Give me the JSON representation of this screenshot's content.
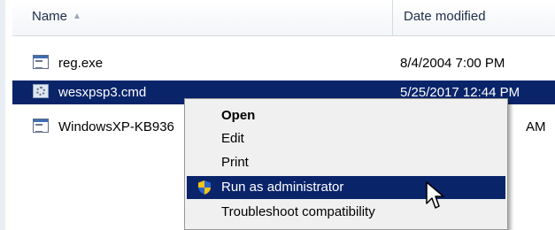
{
  "columns": {
    "name": "Name",
    "date": "Date modified"
  },
  "rows": [
    {
      "name": "reg.exe",
      "date": "8/4/2004 7:00 PM",
      "icon": "exe-file-icon"
    },
    {
      "name": "wesxpsp3.cmd",
      "date": "5/25/2017 12:44 PM",
      "icon": "cmd-file-icon"
    },
    {
      "name": "WindowsXP-KB936",
      "date": "AM",
      "icon": "exe-file-icon"
    }
  ],
  "context_menu": {
    "items": [
      {
        "label": "Open"
      },
      {
        "label": "Edit"
      },
      {
        "label": "Print"
      },
      {
        "label": "Run as administrator"
      },
      {
        "label": "Troubleshoot compatibility"
      }
    ]
  }
}
